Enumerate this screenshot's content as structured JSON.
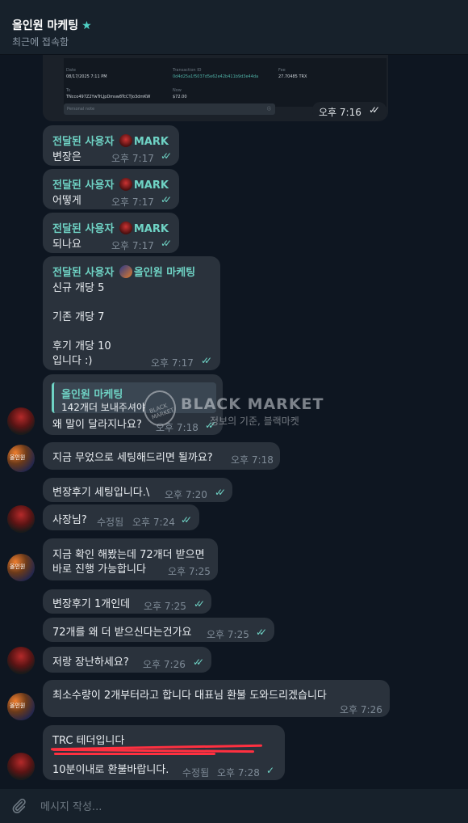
{
  "header": {
    "title": "올인원 마케팅",
    "status": "최근에 접속함"
  },
  "card": {
    "date_label": "Date",
    "date_value": "08/17/2025 7:11 PM",
    "txid_label": "Transaction ID",
    "txid_value": "0d4d25a1f5037d5e62e42b411b9d3e44da",
    "fee_label": "Fee",
    "fee_value": "27.70485 TRX",
    "to_label": "To",
    "to_value": "TNcco497Z2YwTrLJpDmsw8TcCTJo3dmKW",
    "now_label": "Now",
    "now_value": "$72.00",
    "note_placeholder": "Personal note",
    "time": "오후 7:16"
  },
  "messages": [
    {
      "sender": "전달된 사용자",
      "tag": "MARK",
      "text": "변장은",
      "time": "오후 7:17"
    },
    {
      "sender": "전달된 사용자",
      "tag": "MARK",
      "text": "어떻게",
      "time": "오후 7:17"
    },
    {
      "sender": "전달된 사용자",
      "tag": "MARK",
      "text": "되나요",
      "time": "오후 7:17"
    },
    {
      "sender": "전달된 사용자",
      "tag": "올인원 마케팅",
      "line1": "신규 개당 5",
      "line2": "기존 개당 7",
      "line3": "후기 개당 10",
      "line4": "입니다 :)",
      "time": "오후 7:17"
    },
    {
      "quote_name": "올인원 마케팅",
      "quote_text": "142개더 보내주셔야",
      "text": "왜 말이 달라지나요?",
      "time": "오후 7:18"
    },
    {
      "text": "지금 무었으로 세팅해드리면 될까요?",
      "time": "오후 7:18"
    },
    {
      "text": "변장후기 세팅입니다.\\",
      "time": "오후 7:20"
    },
    {
      "text": "사장님?",
      "edited": "수정됨",
      "time": "오후 7:24"
    },
    {
      "line1": "지금 확인 해봤는데 72개더 받으면",
      "line2": "바로 진행 가능합니다",
      "time": "오후 7:25"
    },
    {
      "text": "변장후기 1개인데",
      "time": "오후 7:25"
    },
    {
      "text": "72개를 왜 더 받으신다는건가요",
      "time": "오후 7:25"
    },
    {
      "text": "저랑 장난하세요?",
      "time": "오후 7:26"
    },
    {
      "text": "최소수량이 2개부터라고 합니다 대표님 환불 도와드리겠습니다",
      "time": "오후 7:26"
    },
    {
      "line1": "TRC 테더입니다",
      "line3": "10분이내로 환불바랍니다.",
      "edited": "수정됨",
      "time": "오후 7:28"
    }
  ],
  "avatar_label": "올인원\n마케팅",
  "watermark": {
    "title": "BLACK MARKET",
    "subtitle": "정보의 기준, 블랙마켓",
    "logo_text": "BLACK MARKET"
  },
  "compose": {
    "placeholder": "메시지 작성..."
  },
  "colors": {
    "accent": "#6fd3c5",
    "bubble": "#2a323c",
    "background": "#0e1621",
    "header": "#17212b"
  }
}
